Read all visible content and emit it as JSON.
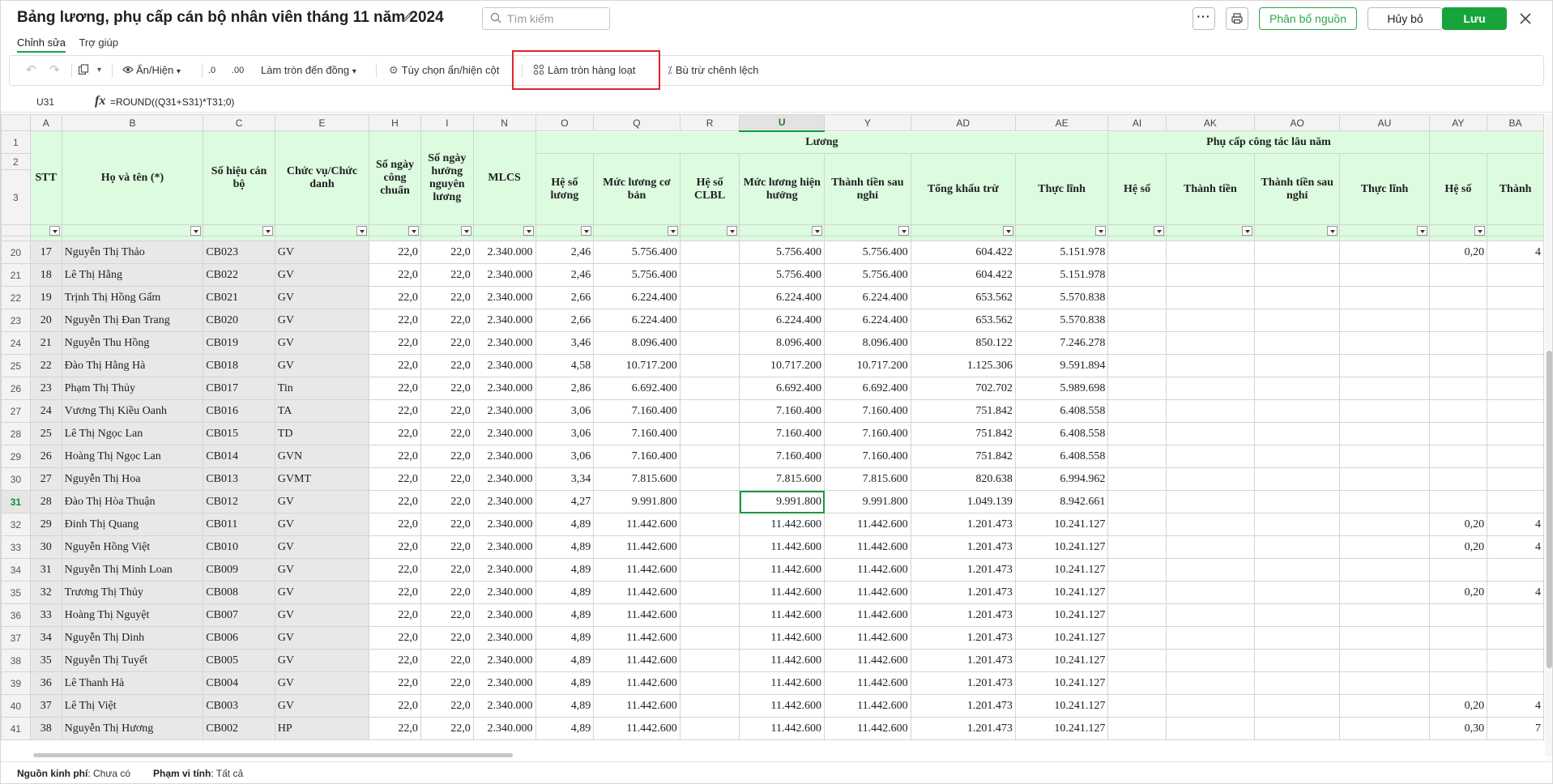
{
  "header": {
    "title": "Bảng lương, phụ cấp cán bộ nhân viên tháng 11 năm 2024",
    "search_placeholder": "Tìm kiếm",
    "more_label": "···",
    "allocate_label": "Phân bổ nguồn",
    "cancel_label": "Hủy bỏ",
    "save_label": "Lưu",
    "accent_color": "#17a43b"
  },
  "tabs": [
    "Chỉnh sửa",
    "Trợ giúp"
  ],
  "toolbar": {
    "show_hide": "Ẩn/Hiện",
    "decrease_decimal": ".0",
    "increase_decimal": ".00",
    "round_to": "Làm tròn đến đồng",
    "column_options": "Tùy chọn ẩn/hiện cột",
    "batch_round": "Làm tròn hàng loạt",
    "offset_diff": "Bù trừ chênh lệch",
    "highlight_color": "#e0242a"
  },
  "formula_bar": {
    "cell_ref": "U31",
    "fx": "fx",
    "formula": "=ROUND((Q31+S31)*T31;0)"
  },
  "grid": {
    "col_letters": [
      "A",
      "B",
      "C",
      "E",
      "H",
      "I",
      "N",
      "O",
      "Q",
      "R",
      "U",
      "Y",
      "AD",
      "AE",
      "AI",
      "AK",
      "AO",
      "AU",
      "AY",
      "BA"
    ],
    "header_row_numbers": [
      "1",
      "2",
      "3"
    ],
    "group_luong": "Lương",
    "group_phucap": "Phụ cấp công tác lâu năm",
    "headers": {
      "stt": "STT",
      "name": "Họ và tên (*)",
      "code": "Số hiệu cán bộ",
      "position": "Chức vụ/Chức danh",
      "days_std": "Số ngày công chuẩn",
      "days_paid": "Số ngày hưởng nguyên lương",
      "mlcs": "MLCS",
      "coef": "Hệ số lương",
      "base": "Mức lương cơ bản",
      "clbl": "Hệ số CLBL",
      "current": "Mức lương hiện hưởng",
      "after_leave": "Thành tiền sau nghỉ",
      "deduction": "Tổng khấu trừ",
      "net": "Thực lĩnh",
      "pc_coef": "Hệ số",
      "pc_amount": "Thành tiền",
      "pc_after": "Thành tiền sau nghỉ",
      "pc_net": "Thực lĩnh",
      "ay_coef": "Hệ số",
      "ba_amount": "Thành"
    },
    "rows": [
      {
        "rn": "20",
        "stt": "17",
        "name": "Nguyễn Thị Thảo",
        "code": "CB023",
        "pos": "GV",
        "h": "22,0",
        "i": "22,0",
        "mlcs": "2.340.000",
        "coef": "2,46",
        "base": "5.756.400",
        "clbl": "",
        "cur": "5.756.400",
        "after": "5.756.400",
        "ded": "604.422",
        "net": "5.151.978",
        "ay": "0,20",
        "ba": "4"
      },
      {
        "rn": "21",
        "stt": "18",
        "name": "Lê Thị Hằng",
        "code": "CB022",
        "pos": "GV",
        "h": "22,0",
        "i": "22,0",
        "mlcs": "2.340.000",
        "coef": "2,46",
        "base": "5.756.400",
        "clbl": "",
        "cur": "5.756.400",
        "after": "5.756.400",
        "ded": "604.422",
        "net": "5.151.978",
        "ay": "",
        "ba": ""
      },
      {
        "rn": "22",
        "stt": "19",
        "name": "Trịnh Thị Hồng Gấm",
        "code": "CB021",
        "pos": "GV",
        "h": "22,0",
        "i": "22,0",
        "mlcs": "2.340.000",
        "coef": "2,66",
        "base": "6.224.400",
        "clbl": "",
        "cur": "6.224.400",
        "after": "6.224.400",
        "ded": "653.562",
        "net": "5.570.838",
        "ay": "",
        "ba": ""
      },
      {
        "rn": "23",
        "stt": "20",
        "name": "Nguyễn Thị  Đan Trang",
        "code": "CB020",
        "pos": "GV",
        "h": "22,0",
        "i": "22,0",
        "mlcs": "2.340.000",
        "coef": "2,66",
        "base": "6.224.400",
        "clbl": "",
        "cur": "6.224.400",
        "after": "6.224.400",
        "ded": "653.562",
        "net": "5.570.838",
        "ay": "",
        "ba": ""
      },
      {
        "rn": "24",
        "stt": "21",
        "name": "Nguyễn Thu Hồng",
        "code": "CB019",
        "pos": "GV",
        "h": "22,0",
        "i": "22,0",
        "mlcs": "2.340.000",
        "coef": "3,46",
        "base": "8.096.400",
        "clbl": "",
        "cur": "8.096.400",
        "after": "8.096.400",
        "ded": "850.122",
        "net": "7.246.278",
        "ay": "",
        "ba": ""
      },
      {
        "rn": "25",
        "stt": "22",
        "name": "Đào Thị Hằng Hà",
        "code": "CB018",
        "pos": "GV",
        "h": "22,0",
        "i": "22,0",
        "mlcs": "2.340.000",
        "coef": "4,58",
        "base": "10.717.200",
        "clbl": "",
        "cur": "10.717.200",
        "after": "10.717.200",
        "ded": "1.125.306",
        "net": "9.591.894",
        "ay": "",
        "ba": ""
      },
      {
        "rn": "26",
        "stt": "23",
        "name": "Phạm Thị Thủy",
        "code": "CB017",
        "pos": "Tin",
        "h": "22,0",
        "i": "22,0",
        "mlcs": "2.340.000",
        "coef": "2,86",
        "base": "6.692.400",
        "clbl": "",
        "cur": "6.692.400",
        "after": "6.692.400",
        "ded": "702.702",
        "net": "5.989.698",
        "ay": "",
        "ba": ""
      },
      {
        "rn": "27",
        "stt": "24",
        "name": "Vương Thị Kiều Oanh",
        "code": "CB016",
        "pos": "TA",
        "h": "22,0",
        "i": "22,0",
        "mlcs": "2.340.000",
        "coef": "3,06",
        "base": "7.160.400",
        "clbl": "",
        "cur": "7.160.400",
        "after": "7.160.400",
        "ded": "751.842",
        "net": "6.408.558",
        "ay": "",
        "ba": ""
      },
      {
        "rn": "28",
        "stt": "25",
        "name": "Lê Thị Ngọc Lan",
        "code": "CB015",
        "pos": "TD",
        "h": "22,0",
        "i": "22,0",
        "mlcs": "2.340.000",
        "coef": "3,06",
        "base": "7.160.400",
        "clbl": "",
        "cur": "7.160.400",
        "after": "7.160.400",
        "ded": "751.842",
        "net": "6.408.558",
        "ay": "",
        "ba": ""
      },
      {
        "rn": "29",
        "stt": "26",
        "name": "Hoàng Thị Ngọc Lan",
        "code": "CB014",
        "pos": "GVN",
        "h": "22,0",
        "i": "22,0",
        "mlcs": "2.340.000",
        "coef": "3,06",
        "base": "7.160.400",
        "clbl": "",
        "cur": "7.160.400",
        "after": "7.160.400",
        "ded": "751.842",
        "net": "6.408.558",
        "ay": "",
        "ba": ""
      },
      {
        "rn": "30",
        "stt": "27",
        "name": "Nguyễn Thị Hoa",
        "code": "CB013",
        "pos": "GVMT",
        "h": "22,0",
        "i": "22,0",
        "mlcs": "2.340.000",
        "coef": "3,34",
        "base": "7.815.600",
        "clbl": "",
        "cur": "7.815.600",
        "after": "7.815.600",
        "ded": "820.638",
        "net": "6.994.962",
        "ay": "",
        "ba": ""
      },
      {
        "rn": "31",
        "stt": "28",
        "name": "Đào Thị  Hòa Thuận",
        "code": "CB012",
        "pos": "GV",
        "h": "22,0",
        "i": "22,0",
        "mlcs": "2.340.000",
        "coef": "4,27",
        "base": "9.991.800",
        "clbl": "",
        "cur": "9.991.800",
        "after": "9.991.800",
        "ded": "1.049.139",
        "net": "8.942.661",
        "ay": "",
        "ba": "",
        "active": true
      },
      {
        "rn": "32",
        "stt": "29",
        "name": "Đinh Thị Quang",
        "code": "CB011",
        "pos": "GV",
        "h": "22,0",
        "i": "22,0",
        "mlcs": "2.340.000",
        "coef": "4,89",
        "base": "11.442.600",
        "clbl": "",
        "cur": "11.442.600",
        "after": "11.442.600",
        "ded": "1.201.473",
        "net": "10.241.127",
        "ay": "0,20",
        "ba": "4"
      },
      {
        "rn": "33",
        "stt": "30",
        "name": "Nguyễn Hồng Việt",
        "code": "CB010",
        "pos": "GV",
        "h": "22,0",
        "i": "22,0",
        "mlcs": "2.340.000",
        "coef": "4,89",
        "base": "11.442.600",
        "clbl": "",
        "cur": "11.442.600",
        "after": "11.442.600",
        "ded": "1.201.473",
        "net": "10.241.127",
        "ay": "0,20",
        "ba": "4"
      },
      {
        "rn": "34",
        "stt": "31",
        "name": "Nguyễn Thị Minh Loan",
        "code": "CB009",
        "pos": "GV",
        "h": "22,0",
        "i": "22,0",
        "mlcs": "2.340.000",
        "coef": "4,89",
        "base": "11.442.600",
        "clbl": "",
        "cur": "11.442.600",
        "after": "11.442.600",
        "ded": "1.201.473",
        "net": "10.241.127",
        "ay": "",
        "ba": ""
      },
      {
        "rn": "35",
        "stt": "32",
        "name": "Trương Thị Thủy",
        "code": "CB008",
        "pos": "GV",
        "h": "22,0",
        "i": "22,0",
        "mlcs": "2.340.000",
        "coef": "4,89",
        "base": "11.442.600",
        "clbl": "",
        "cur": "11.442.600",
        "after": "11.442.600",
        "ded": "1.201.473",
        "net": "10.241.127",
        "ay": "0,20",
        "ba": "4"
      },
      {
        "rn": "36",
        "stt": "33",
        "name": "Hoàng Thị Nguyệt",
        "code": "CB007",
        "pos": "GV",
        "h": "22,0",
        "i": "22,0",
        "mlcs": "2.340.000",
        "coef": "4,89",
        "base": "11.442.600",
        "clbl": "",
        "cur": "11.442.600",
        "after": "11.442.600",
        "ded": "1.201.473",
        "net": "10.241.127",
        "ay": "",
        "ba": ""
      },
      {
        "rn": "37",
        "stt": "34",
        "name": "Nguyễn Thị Dinh",
        "code": "CB006",
        "pos": "GV",
        "h": "22,0",
        "i": "22,0",
        "mlcs": "2.340.000",
        "coef": "4,89",
        "base": "11.442.600",
        "clbl": "",
        "cur": "11.442.600",
        "after": "11.442.600",
        "ded": "1.201.473",
        "net": "10.241.127",
        "ay": "",
        "ba": ""
      },
      {
        "rn": "38",
        "stt": "35",
        "name": "Nguyễn Thị Tuyết",
        "code": "CB005",
        "pos": "GV",
        "h": "22,0",
        "i": "22,0",
        "mlcs": "2.340.000",
        "coef": "4,89",
        "base": "11.442.600",
        "clbl": "",
        "cur": "11.442.600",
        "after": "11.442.600",
        "ded": "1.201.473",
        "net": "10.241.127",
        "ay": "",
        "ba": ""
      },
      {
        "rn": "39",
        "stt": "36",
        "name": "Lê Thanh Hà",
        "code": "CB004",
        "pos": "GV",
        "h": "22,0",
        "i": "22,0",
        "mlcs": "2.340.000",
        "coef": "4,89",
        "base": "11.442.600",
        "clbl": "",
        "cur": "11.442.600",
        "after": "11.442.600",
        "ded": "1.201.473",
        "net": "10.241.127",
        "ay": "",
        "ba": ""
      },
      {
        "rn": "40",
        "stt": "37",
        "name": "Lê Thị Việt",
        "code": "CB003",
        "pos": "GV",
        "h": "22,0",
        "i": "22,0",
        "mlcs": "2.340.000",
        "coef": "4,89",
        "base": "11.442.600",
        "clbl": "",
        "cur": "11.442.600",
        "after": "11.442.600",
        "ded": "1.201.473",
        "net": "10.241.127",
        "ay": "0,20",
        "ba": "4"
      },
      {
        "rn": "41",
        "stt": "38",
        "name": "Nguyễn Thị Hương",
        "code": "CB002",
        "pos": "HP",
        "h": "22,0",
        "i": "22,0",
        "mlcs": "2.340.000",
        "coef": "4,89",
        "base": "11.442.600",
        "clbl": "",
        "cur": "11.442.600",
        "after": "11.442.600",
        "ded": "1.201.473",
        "net": "10.241.127",
        "ay": "0,30",
        "ba": "7"
      }
    ]
  },
  "footer": {
    "funding_label": "Nguồn kinh phí",
    "funding_value": "Chưa có",
    "scope_label": "Phạm vi tính",
    "scope_value": "Tất cả"
  }
}
